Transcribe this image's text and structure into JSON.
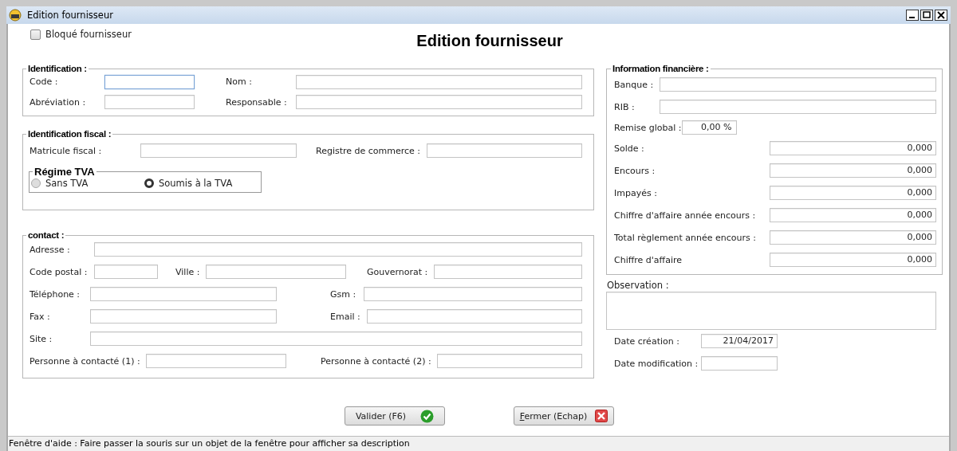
{
  "window": {
    "title": "Edition fournisseur"
  },
  "blocked": {
    "label": "Bloqué fournisseur",
    "checked": false
  },
  "heading": "Edition fournisseur",
  "identification": {
    "legend": "Identification :",
    "fields": [
      {
        "label": "Code :",
        "focused": true
      },
      {
        "label": "Nom :",
        "focused": false
      },
      {
        "label": "Abréviation :",
        "focused": false
      },
      {
        "label": "Responsable :",
        "focused": false
      }
    ]
  },
  "fiscal": {
    "legend": "Identification fiscal :",
    "fields": [
      {
        "label": "Matricule fiscal :"
      },
      {
        "label": "Registre de commerce :"
      }
    ],
    "regime": {
      "legend": "Régime TVA",
      "options": [
        {
          "label": "Sans TVA",
          "selected": false
        },
        {
          "label": "Soumis à la TVA",
          "selected": true
        }
      ]
    }
  },
  "contact": {
    "legend": "contact :",
    "fields": [
      {
        "label": "Adresse :"
      },
      {
        "label": "Code postal :"
      },
      {
        "label": "Ville :"
      },
      {
        "label": "Gouvernorat :"
      },
      {
        "label": "Téléphone :"
      },
      {
        "label": "Gsm :"
      },
      {
        "label": "Fax :"
      },
      {
        "label": "Email :"
      },
      {
        "label": "Site :"
      },
      {
        "label": "Personne à contacté (1) :"
      },
      {
        "label": "Personne à contacté (2) :"
      }
    ]
  },
  "finance": {
    "legend": "Information financière :",
    "fields": [
      {
        "kind": "text",
        "label": "Banque :"
      },
      {
        "kind": "text",
        "label": "RIB :"
      },
      {
        "kind": "percent",
        "label": "Remise global :",
        "value": "0,00 %"
      },
      {
        "kind": "amount",
        "label": "Solde :",
        "value": "0,000"
      },
      {
        "kind": "amount",
        "label": "Encours :",
        "value": "0,000"
      },
      {
        "kind": "amount",
        "label": "Impayés :",
        "value": "0,000"
      },
      {
        "kind": "amount",
        "label": "Chiffre d'affaire année encours :",
        "value": "0,000"
      },
      {
        "kind": "amount",
        "label": "Total règlement année encours :",
        "value": "0,000"
      },
      {
        "kind": "amount",
        "label": "Chiffre d'affaire",
        "value": "0,000"
      }
    ]
  },
  "observation": {
    "label": "Observation :"
  },
  "dates": [
    {
      "label": "Date création :",
      "value": "21/04/2017"
    },
    {
      "label": "Date modification :"
    }
  ],
  "buttons": [
    {
      "label": "Valider (F6)",
      "kind": "ok"
    },
    {
      "label": "Fermer (Echap)",
      "kind": "cancel"
    }
  ],
  "status_bar": "Fenêtre d'aide : Faire passer la souris sur un objet de la fenêtre pour afficher sa description"
}
